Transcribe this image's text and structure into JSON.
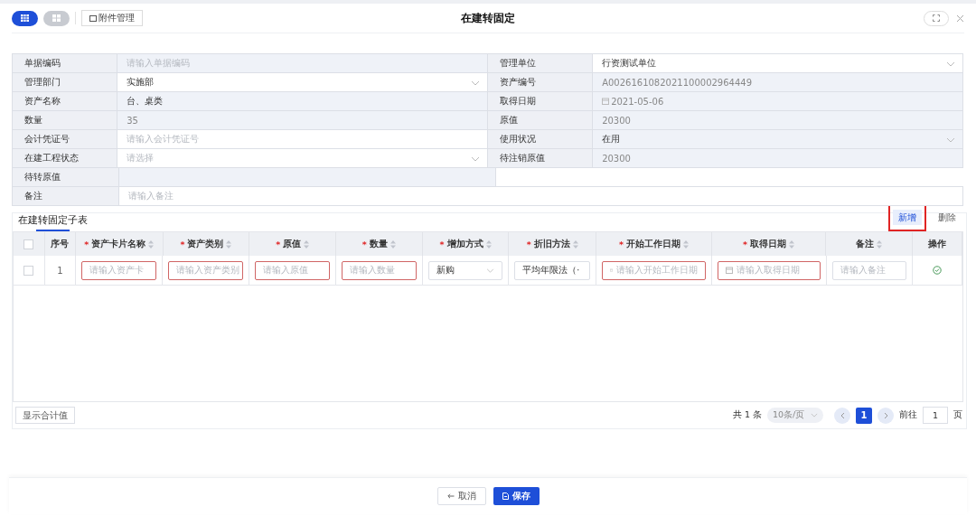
{
  "toolbar": {
    "view_toggles": [
      {
        "kind": "table",
        "selected": true
      },
      {
        "kind": "grid",
        "selected": false
      }
    ],
    "attachment_button": "附件管理"
  },
  "window": {
    "title": "在建转固定"
  },
  "form": {
    "rows": [
      [
        {
          "label": "单据编码",
          "kind": "text",
          "placeholder": "请输入单据编码",
          "disabled": true
        },
        {
          "label": "管理单位",
          "kind": "select",
          "value": "行资测试单位",
          "disabled": false
        }
      ],
      [
        {
          "label": "管理部门",
          "kind": "select",
          "value": "实施部",
          "disabled": false
        },
        {
          "label": "资产编号",
          "kind": "text",
          "value": "A0026161082021100002964449",
          "disabled": true
        }
      ],
      [
        {
          "label": "资产名称",
          "kind": "text",
          "value": "台、桌类",
          "disabled": false,
          "readonly": true
        },
        {
          "label": "取得日期",
          "kind": "date",
          "value": "2021-05-06",
          "disabled": true
        }
      ],
      [
        {
          "label": "数量",
          "kind": "text",
          "value": "35",
          "disabled": true
        },
        {
          "label": "原值",
          "kind": "text",
          "value": "20300",
          "disabled": true
        }
      ],
      [
        {
          "label": "会计凭证号",
          "kind": "text",
          "placeholder": "请输入会计凭证号",
          "disabled": false
        },
        {
          "label": "使用状况",
          "kind": "select",
          "value": "在用",
          "disabled": false,
          "readonly": true
        }
      ],
      [
        {
          "label": "在建工程状态",
          "kind": "select",
          "placeholder": "请选择",
          "disabled": false
        },
        {
          "label": "待注销原值",
          "kind": "text",
          "value": "20300",
          "disabled": true
        }
      ],
      [
        {
          "label": "待转原值",
          "kind": "text",
          "disabled": true
        }
      ],
      [
        {
          "label": "备注",
          "kind": "text",
          "placeholder": "请输入备注",
          "disabled": false,
          "wide": true
        }
      ]
    ]
  },
  "subtable": {
    "tabs": [
      {
        "label": "在建转固定子表",
        "selected": true
      }
    ],
    "actions": [
      {
        "label": "新增",
        "kind": "primary",
        "highlighted": true
      },
      {
        "label": "删除",
        "kind": "plain",
        "highlighted": false
      }
    ],
    "columns": [
      {
        "kind": "checkbox",
        "checked": false
      },
      {
        "kind": "text",
        "label": "序号",
        "sortable": false
      },
      {
        "kind": "text",
        "marker": "*",
        "label": "资产卡片名称",
        "sortable": true
      },
      {
        "kind": "text",
        "marker": "*",
        "label": "资产类别",
        "sortable": true
      },
      {
        "kind": "text",
        "marker": "*",
        "label": "原值",
        "sortable": true
      },
      {
        "kind": "text",
        "marker": "*",
        "label": "数量",
        "sortable": true
      },
      {
        "kind": "text",
        "marker": "*",
        "label": "增加方式",
        "sortable": true
      },
      {
        "kind": "text",
        "marker": "*",
        "label": "折旧方法",
        "sortable": true
      },
      {
        "kind": "text",
        "marker": "*",
        "label": "开始工作日期",
        "sortable": true
      },
      {
        "kind": "text",
        "marker": "*",
        "label": "取得日期",
        "sortable": true
      },
      {
        "kind": "text",
        "label": "备注",
        "sortable": true
      },
      {
        "kind": "text",
        "label": "操作",
        "sortable": false
      }
    ],
    "rows": [
      {
        "cells": [
          {
            "kind": "checkbox",
            "checked": false
          },
          {
            "kind": "index",
            "value": "1"
          },
          {
            "kind": "input",
            "placeholder": "请输入资产卡",
            "invalid": true
          },
          {
            "kind": "input",
            "placeholder": "请输入资产类别",
            "invalid": true
          },
          {
            "kind": "input",
            "placeholder": "请输入原值",
            "invalid": true
          },
          {
            "kind": "input",
            "placeholder": "请输入数量",
            "invalid": true
          },
          {
            "kind": "select",
            "value": "新购",
            "invalid": false
          },
          {
            "kind": "select",
            "value": "平均年限法（·",
            "invalid": false
          },
          {
            "kind": "date",
            "placeholder": "请输入开始工作日期",
            "invalid": true
          },
          {
            "kind": "date",
            "placeholder": "请输入取得日期",
            "invalid": true
          },
          {
            "kind": "input",
            "placeholder": "请输入备注",
            "invalid": false
          },
          {
            "kind": "action"
          }
        ]
      }
    ],
    "footer": {
      "summary_button": "显示合计值",
      "total": "共 1 条",
      "page_size": "10条/页",
      "pages": [
        {
          "label": "1",
          "selected": true
        }
      ],
      "goto_label": "前往",
      "goto_value": "1",
      "goto_suffix": "页"
    }
  },
  "bottom_bar": {
    "buttons": [
      {
        "label": "取消",
        "kind": "cancel"
      },
      {
        "label": "保存",
        "kind": "save"
      }
    ]
  }
}
